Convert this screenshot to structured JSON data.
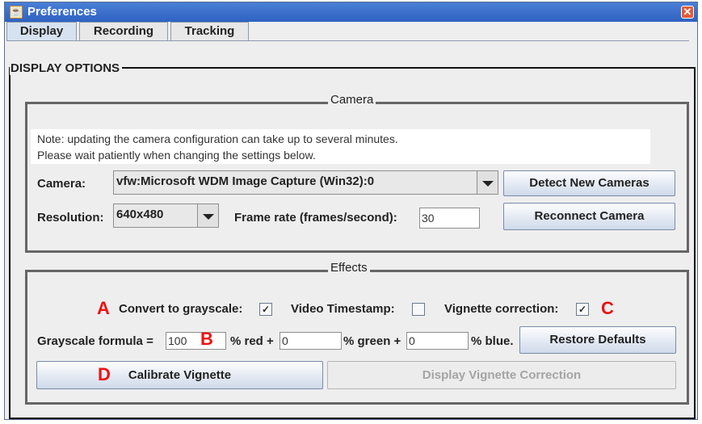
{
  "window": {
    "title": "Preferences"
  },
  "tabs": [
    {
      "label": "Display",
      "active": true
    },
    {
      "label": "Recording",
      "active": false
    },
    {
      "label": "Tracking",
      "active": false
    }
  ],
  "display_options": {
    "title": "DISPLAY OPTIONS"
  },
  "camera": {
    "title": "Camera",
    "note_line1": "Note: updating the camera configuration can take up to several minutes.",
    "note_line2": "Please wait patiently when changing the settings below.",
    "camera_label": "Camera:",
    "camera_value": "vfw:Microsoft WDM Image Capture (Win32):0",
    "detect_button": "Detect New Cameras",
    "resolution_label": "Resolution:",
    "resolution_value": "640x480",
    "framerate_label": "Frame rate (frames/second):",
    "framerate_value": "30",
    "reconnect_button": "Reconnect Camera"
  },
  "effects": {
    "title": "Effects",
    "marker_a": "A",
    "marker_b": "B",
    "marker_c": "C",
    "marker_d": "D",
    "grayscale_label": "Convert to grayscale:",
    "grayscale_checked": true,
    "timestamp_label": "Video Timestamp:",
    "timestamp_checked": false,
    "vignette_label": "Vignette correction:",
    "vignette_checked": true,
    "formula_label": "Grayscale formula =",
    "red_value": "100",
    "red_label": "% red +",
    "green_value": "0",
    "green_label": "% green +",
    "blue_value": "0",
    "blue_label": "% blue.",
    "restore_button": "Restore Defaults",
    "calibrate_button": "Calibrate Vignette",
    "display_vignette_button": "Display Vignette Correction"
  },
  "colors": {
    "marker": "#ee1111",
    "titlebar": "#2f62c2"
  }
}
